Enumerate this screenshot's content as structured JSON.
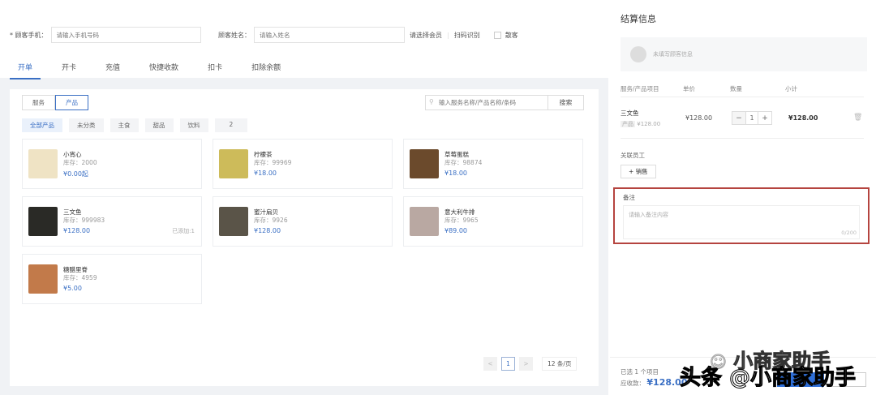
{
  "customer": {
    "phone_label": "* 顾客手机：",
    "phone_placeholder": "请输入手机号码",
    "name_label": "顾客姓名：",
    "name_placeholder": "请输入姓名",
    "member_label": "请选择会员",
    "scan_label": "扫码识别",
    "walkin_label": "散客"
  },
  "tabs": [
    "开单",
    "开卡",
    "充值",
    "快捷收款",
    "扣卡",
    "扣除余额"
  ],
  "segments": [
    "服务",
    "产品"
  ],
  "search": {
    "placeholder": "输入服务名称/产品名称/条码",
    "button": "搜索"
  },
  "categories": [
    "全部产品",
    "未分类",
    "主食",
    "甜品",
    "饮料",
    "2"
  ],
  "products": [
    {
      "name": "小宵心",
      "stock": "库存：2000",
      "price": "¥0.00起",
      "added": "",
      "color": "#efe3c4"
    },
    {
      "name": "柠檬茶",
      "stock": "库存：99969",
      "price": "¥18.00",
      "added": "",
      "color": "#cdbb5a"
    },
    {
      "name": "草莓蛋糕",
      "stock": "库存：98874",
      "price": "¥18.00",
      "added": "",
      "color": "#6b4a2c"
    },
    {
      "name": "三文鱼",
      "stock": "库存：999983",
      "price": "¥128.00",
      "added": "已添加:1",
      "color": "#2a2a26"
    },
    {
      "name": "蜜汁扇贝",
      "stock": "库存：9926",
      "price": "¥128.00",
      "added": "",
      "color": "#5a5448"
    },
    {
      "name": "意大利牛排",
      "stock": "库存：9965",
      "price": "¥89.00",
      "added": "",
      "color": "#b9a8a2"
    },
    {
      "name": "糖醋里脊",
      "stock": "库存：4959",
      "price": "¥5.00",
      "added": "",
      "color": "#c27a4a"
    }
  ],
  "pagination": {
    "prev": "<",
    "page": "1",
    "next": ">",
    "page_size": "12 条/页"
  },
  "checkout": {
    "title": "结算信息",
    "no_customer": "未填写顾客信息",
    "headers": [
      "服务/产品项目",
      "单价",
      "数量",
      "小计"
    ],
    "item": {
      "name": "三文鱼",
      "tag": "产品",
      "orig_price": "¥128.00",
      "unit_price": "¥128.00",
      "qty": "1",
      "minus": "−",
      "plus": "+",
      "subtotal": "¥128.00"
    },
    "staff_label": "关联员工",
    "add_sales": "+ 销售",
    "note_label": "备注",
    "note_placeholder": "请输入备注内容",
    "note_count": "0/200",
    "selected": "已选 1 个项目",
    "receivable_label": "应收款：",
    "receivable": "¥128.00"
  },
  "watermark": {
    "line1": "小商家助手",
    "line2": "头条 @小商家助手"
  },
  "colors": {
    "accent": "#3a6fc4",
    "highlight": "#b5443f"
  }
}
